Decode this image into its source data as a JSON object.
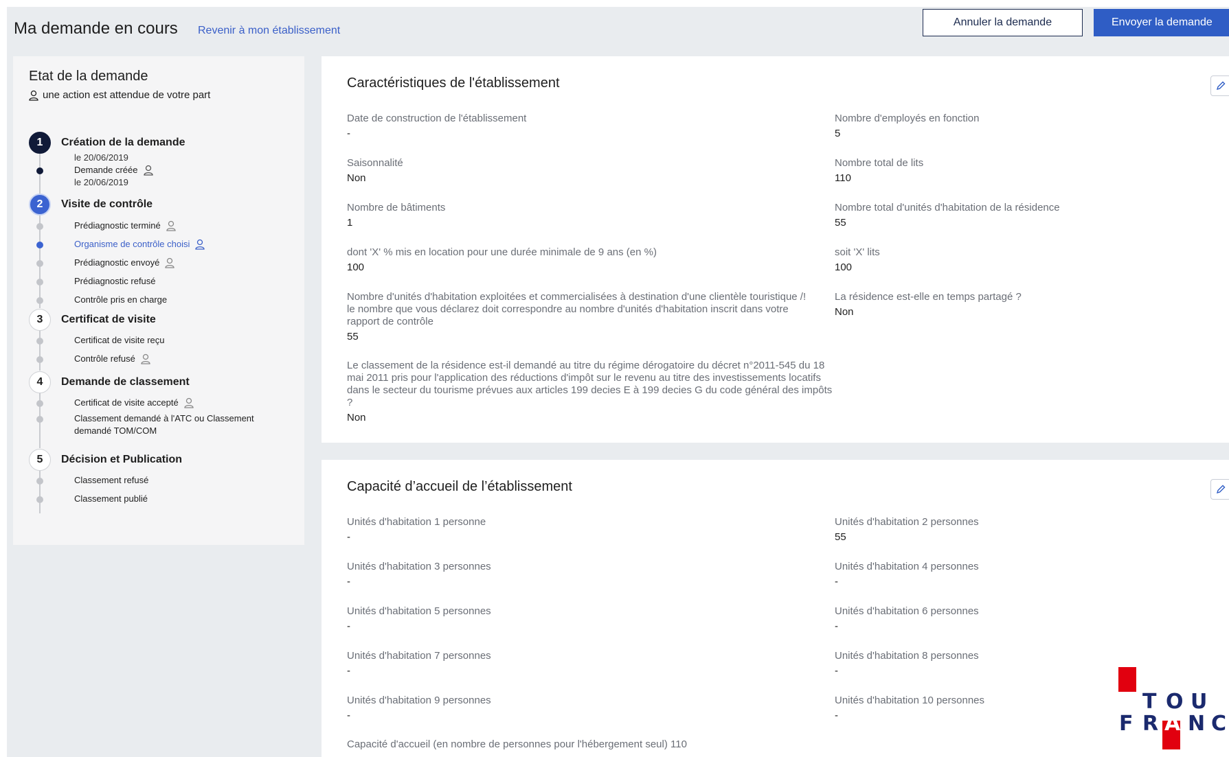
{
  "header": {
    "title": "Ma demande en cours",
    "back_link": "Revenir à mon établissement",
    "cancel_label": "Annuler la demande",
    "send_label": "Envoyer la demande"
  },
  "sidebar": {
    "title": "Etat de la demande",
    "subtitle": "une action est attendue de votre part",
    "steps": [
      {
        "num": "1",
        "name": "Création de la demande",
        "date": "le 20/06/2019",
        "items": [
          {
            "label": "Demande créée",
            "date": "le 20/06/2019"
          }
        ]
      },
      {
        "num": "2",
        "name": "Visite de contrôle",
        "items": [
          {
            "label": "Prédiagnostic terminé"
          },
          {
            "label": "Organisme de contrôle choisi"
          },
          {
            "label": "Prédiagnostic envoyé"
          },
          {
            "label": "Prédiagnostic refusé"
          },
          {
            "label": "Contrôle pris en charge"
          }
        ]
      },
      {
        "num": "3",
        "name": "Certificat de visite",
        "items": [
          {
            "label": "Certificat de visite reçu"
          },
          {
            "label": "Contrôle refusé"
          }
        ]
      },
      {
        "num": "4",
        "name": "Demande de classement",
        "items": [
          {
            "label": "Certificat de visite accepté"
          },
          {
            "label_line1": "Classement demandé à l'ATC ou Classement",
            "label_line2": "demandé TOM/COM"
          }
        ]
      },
      {
        "num": "5",
        "name": "Décision et Publication",
        "items": [
          {
            "label": "Classement refusé"
          },
          {
            "label": "Classement publié"
          }
        ]
      }
    ]
  },
  "caracteristiques": {
    "title": "Caractéristiques de l'établissement",
    "fields": [
      {
        "label": "Date de construction de l'établissement",
        "value": "-"
      },
      {
        "label": "Nombre d'employés en fonction",
        "value": "5"
      },
      {
        "label": "Saisonnalité",
        "value": "Non"
      },
      {
        "label": "Nombre total de lits",
        "value": "110"
      },
      {
        "label": "Nombre de bâtiments",
        "value": "1"
      },
      {
        "label": "Nombre total d'unités d'habitation de la résidence",
        "value": "55"
      },
      {
        "label": "dont 'X' % mis en location pour une durée minimale de 9 ans (en %)",
        "value": "100"
      },
      {
        "label": "soit 'X' lits",
        "value": "100"
      },
      {
        "label": "Nombre d'unités d'habitation exploitées et commercialisées à destination d'une clientèle touristique /! le nombre que vous déclarez doit correspondre au nombre d'unités d'habitation inscrit dans votre rapport de contrôle",
        "value": "55"
      },
      {
        "label": "La résidence est-elle en temps partagé ?",
        "value": "Non"
      },
      {
        "label": "Le classement de la résidence est-il demandé au titre du régime dérogatoire du décret n°2011-545 du 18 mai 2011 pris pour l'application des réductions d'impôt sur le revenu au titre des investissements locatifs dans le secteur du tourisme prévues aux articles 199 decies E à 199 decies G du code général des impôts ?",
        "value": "Non"
      }
    ]
  },
  "capacite": {
    "title": "Capacité d’accueil de l’établissement",
    "fields": [
      {
        "label": "Unités d'habitation 1 personne",
        "value": "-"
      },
      {
        "label": "Unités d'habitation 2 personnes",
        "value": "55"
      },
      {
        "label": "Unités d'habitation 3 personnes",
        "value": "-"
      },
      {
        "label": "Unités d'habitation 4 personnes",
        "value": "-"
      },
      {
        "label": "Unités d'habitation 5 personnes",
        "value": "-"
      },
      {
        "label": "Unités d'habitation 6 personnes",
        "value": "-"
      },
      {
        "label": "Unités d'habitation 7 personnes",
        "value": "-"
      },
      {
        "label": "Unités d'habitation 8 personnes",
        "value": "-"
      },
      {
        "label": "Unités d'habitation 9 personnes",
        "value": "-"
      },
      {
        "label": "Unités d'habitation 10 personnes",
        "value": "-"
      }
    ],
    "capacity_line": "Capacité d'accueil (en nombre de personnes pour l'hébergement seul) 110"
  },
  "logo": {
    "row1": [
      "A",
      "T",
      "O",
      "U"
    ],
    "row2": [
      "F",
      "R",
      "A",
      "N",
      "C"
    ]
  },
  "colors": {
    "primary": "#2f5dc5",
    "navy": "#101a38",
    "link": "#3a5fc8",
    "logo_red": "#e1000f"
  }
}
